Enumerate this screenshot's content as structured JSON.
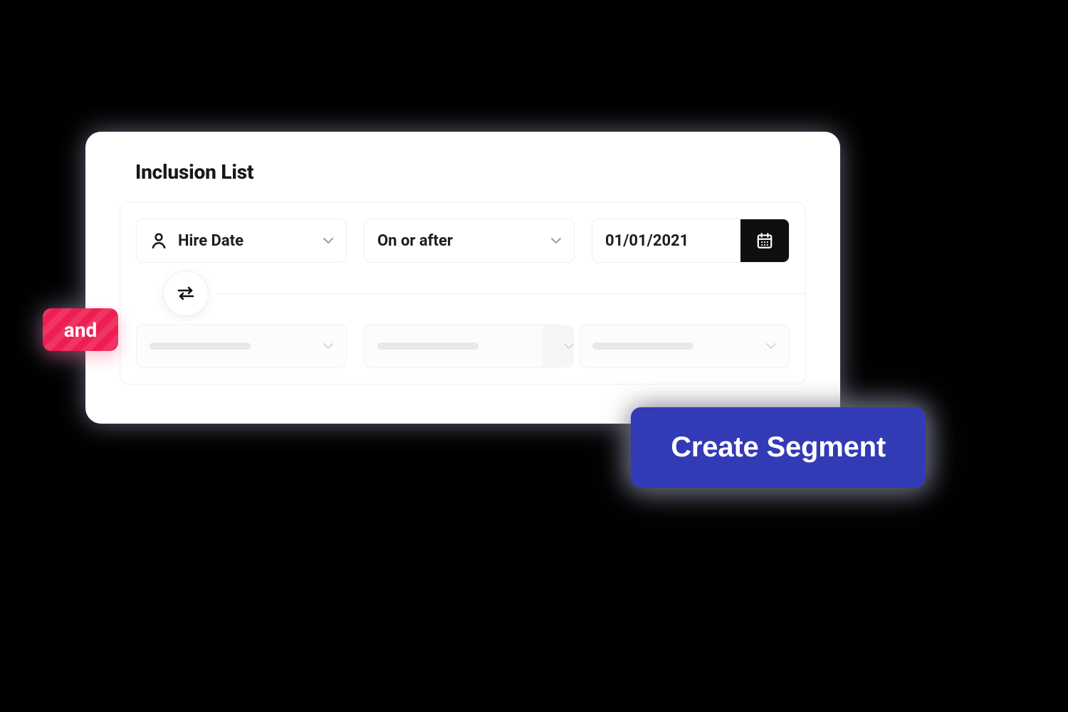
{
  "card": {
    "title": "Inclusion List"
  },
  "rule1": {
    "field_label": "Hire Date",
    "operator_label": "On or after",
    "value": "01/01/2021"
  },
  "connector": {
    "label": "and"
  },
  "cta": {
    "label": "Create Segment"
  },
  "colors": {
    "primary": "#333ab5",
    "accent": "#ee1d52",
    "text": "#17181c"
  }
}
